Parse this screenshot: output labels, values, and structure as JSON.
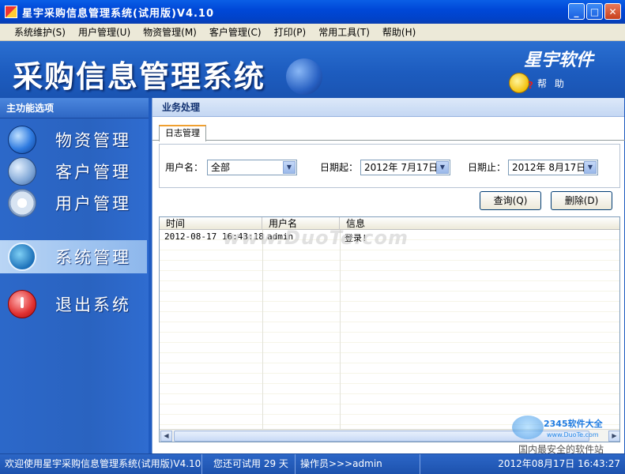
{
  "window": {
    "title": "星宇采购信息管理系统(试用版)V4.10",
    "btn_min": "_",
    "btn_max": "□",
    "btn_close": "✕"
  },
  "menu": {
    "items": [
      "系统维护(S)",
      "用户管理(U)",
      "物资管理(M)",
      "客户管理(C)",
      "打印(P)",
      "常用工具(T)",
      "帮助(H)"
    ]
  },
  "banner": {
    "title": "采购信息管理系统",
    "brand": "星宇软件",
    "help": "帮 助"
  },
  "sidebar": {
    "header": "主功能选项",
    "items": [
      {
        "label": "物资管理",
        "icon": "globe-icon"
      },
      {
        "label": "客户管理",
        "icon": "monitor-icon"
      },
      {
        "label": "用户管理",
        "icon": "gear-icon"
      },
      {
        "label": "系统管理",
        "icon": "system-icon"
      },
      {
        "label": "退出系统",
        "icon": "power-icon"
      }
    ]
  },
  "main": {
    "section_title": "业务处理",
    "tab": "日志管理",
    "filters": {
      "user_label": "用户名：",
      "user_value": "全部",
      "date_from_label": "日期起：",
      "date_from_value": "2012年 7月17日星",
      "date_to_label": "日期止：",
      "date_to_value": "2012年 8月17日星"
    },
    "buttons": {
      "query": "查询(Q)",
      "delete": "删除(D)"
    },
    "grid": {
      "headers": [
        "时间",
        "用户名",
        "信息"
      ],
      "rows": [
        [
          "2012-08-17 16:43:18",
          "admin",
          "登录!"
        ]
      ]
    },
    "watermark": "www.DuoTe.com"
  },
  "statusbar": {
    "welcome": "欢迎使用星宇采购信息管理系统(试用版)V4.10",
    "trial": "您还可试用 29 天",
    "operator": "操作员>>>admin",
    "datetime": "2012年08月17日 16:43:27"
  },
  "corner_logo": {
    "brand": "2345软件大全",
    "url": "www.DuoTe.com",
    "slogan": "国内最安全的软件站"
  }
}
